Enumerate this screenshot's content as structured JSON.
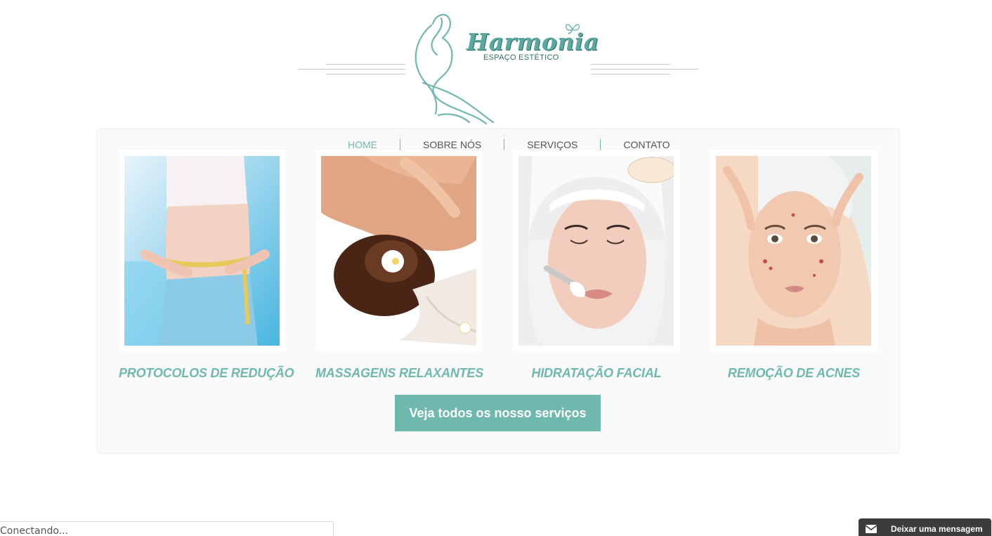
{
  "brand": {
    "name": "Harmonia",
    "tagline": "ESPAÇO ESTÉTICO",
    "accent_color": "#6fb8ae"
  },
  "nav": {
    "items": [
      {
        "label": "HOME",
        "active": true
      },
      {
        "label": "SOBRE NÓS",
        "active": false
      },
      {
        "label": "SERVIÇOS",
        "active": false
      },
      {
        "label": "CONTATO",
        "active": false
      }
    ]
  },
  "services": [
    {
      "title": "PROTOCOLOS DE REDUÇÃO",
      "image": "waist-measuring-photo"
    },
    {
      "title": "MASSAGENS RELAXANTES",
      "image": "back-massage-photo"
    },
    {
      "title": "HIDRATAÇÃO FACIAL",
      "image": "facial-mask-photo"
    },
    {
      "title": "REMOÇÃO DE ACNES",
      "image": "acne-face-photo"
    }
  ],
  "cta": {
    "label": "Veja todos os nosso serviços"
  },
  "status": {
    "connecting": "Conectando..."
  },
  "chat": {
    "label": "Deixar uma mensagem",
    "icon": "mail-icon"
  }
}
